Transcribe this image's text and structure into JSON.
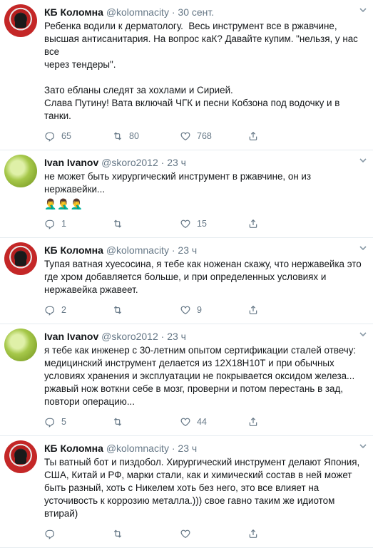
{
  "tweets": [
    {
      "name": "КБ Коломна",
      "handle": "@kolomnacity",
      "dot": "·",
      "time": "30 сент.",
      "text": "Ребенка водили к дерматологу.  Весь инструмент все в ржавчине,\nвысшая антисанитария. На вопрос каК? Давайте купим. \"нельзя, у нас все\nчерез тендеры\".\n\nЗато ебланы следят за хохлами и Сирией.\nСлава Путину! Вата включай ЧГК и песни Кобзона под водочку и в танки.",
      "emoji": "",
      "replies": "65",
      "retweets": "80",
      "likes": "768"
    },
    {
      "name": "Ivan Ivanov",
      "handle": "@skoro2012",
      "dot": "·",
      "time": "23 ч",
      "text": "не может быть хирургический инструмент в ржавчине, он из\nнержавейки...",
      "emoji": "🤦‍♂️🤦‍♂️🤦‍♂️",
      "replies": "1",
      "retweets": "",
      "likes": "15"
    },
    {
      "name": "КБ Коломна",
      "handle": "@kolomnacity",
      "dot": "·",
      "time": "23 ч",
      "text": "Тупая ватная хуесосина, я тебе как ноженан скажу, что нержавейка это\nгде хром добавляется больше, и при определенных условиях и\nнержавейка ржавеет.",
      "emoji": "",
      "replies": "2",
      "retweets": "",
      "likes": "9"
    },
    {
      "name": "Ivan Ivanov",
      "handle": "@skoro2012",
      "dot": "·",
      "time": "23 ч",
      "text": "я тебе как инженер с 30-летним опытом сертификации сталей отвечу:\nмедицинский инструмент делается из 12Х18Н10Т и при обычных\nусловиях хранения и эксплуатации не покрывается оксидом железа...\nржавый нож воткни себе в мозг, проверни и потом перестань в зад,\nповтори операцию...",
      "emoji": "",
      "replies": "5",
      "retweets": "",
      "likes": "44"
    },
    {
      "name": "КБ Коломна",
      "handle": "@kolomnacity",
      "dot": "·",
      "time": "23 ч",
      "text": "Ты ватный бот и пиздобол. Хирургический инструмент делают Япония,\nСША, Китай и РФ, марки стали, как и химический состав в ней может\nбыть разный, хоть с Никелем хоть без него, это все влияет на\nусточивость к коррозию металла.))) свое гавно таким же идиотом\nвтирай)",
      "emoji": "",
      "replies": "",
      "retweets": "",
      "likes": ""
    }
  ],
  "icons": {
    "reply": "reply-icon",
    "retweet": "retweet-icon",
    "like": "heart-icon",
    "share": "share-icon",
    "caret": "chevron-down-icon"
  },
  "colors": {
    "text": "#14171a",
    "muted": "#657786",
    "divider": "#e6ecf0"
  }
}
